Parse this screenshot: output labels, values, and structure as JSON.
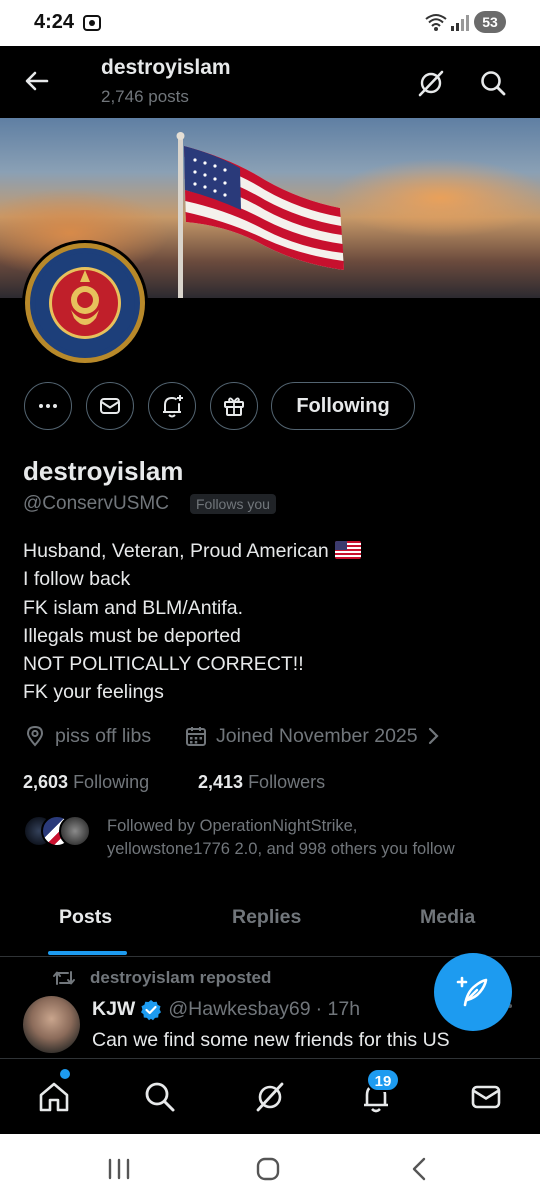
{
  "status_bar": {
    "time": "4:24",
    "battery": "53"
  },
  "header": {
    "title": "destroyislam",
    "subtitle": "2,746 posts"
  },
  "profile": {
    "display_name": "destroyislam",
    "handle": "@ConservUSMC",
    "follows_you_badge": "Follows you",
    "following_button": "Following",
    "bio_lines": [
      "Husband, Veteran, Proud American",
      "I follow back",
      "FK islam and BLM/Antifa.",
      "Illegals must be deported",
      "NOT POLITICALLY CORRECT!!",
      "FK your feelings"
    ],
    "location": "piss off libs",
    "joined": "Joined November 2025",
    "following_count": "2,603",
    "following_label": "Following",
    "followers_count": "2,413",
    "followers_label": "Followers",
    "followed_by_line1": "Followed by OperationNightStrike,",
    "followed_by_line2": "yellowstone1776 2.0, and 998 others you follow"
  },
  "tabs": [
    {
      "label": "Posts",
      "active": true
    },
    {
      "label": "Replies",
      "active": false
    },
    {
      "label": "Media",
      "active": false
    }
  ],
  "post": {
    "repost_label": "destroyislam reposted",
    "author_name": "KJW",
    "author_handle": "@Hawkesbay69",
    "time": "· 17h",
    "text": "Can we find some new friends for this US"
  },
  "bottom_nav": {
    "notifications_badge": "19"
  },
  "colors": {
    "accent": "#1d9bf0",
    "background": "#000000",
    "muted_text": "#71767b",
    "primary_text": "#e7e9ea"
  },
  "icons": [
    "back-arrow-icon",
    "grok-icon",
    "search-icon",
    "more-icon",
    "mail-icon",
    "notify-plus-icon",
    "gift-icon",
    "location-icon",
    "calendar-icon",
    "chevron-right-icon",
    "repost-icon",
    "verified-icon",
    "compose-icon",
    "home-icon",
    "notifications-icon"
  ]
}
